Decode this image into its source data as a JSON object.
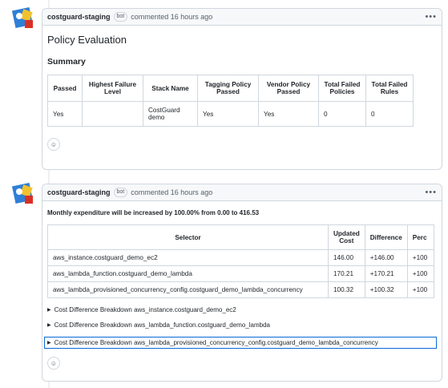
{
  "comments": [
    {
      "author": "costguard-staging",
      "badge": "bot",
      "meta": "commented 16 hours ago",
      "menu_icon": "kebab-horizontal-icon",
      "title": "Policy Evaluation",
      "section": "Summary",
      "table": {
        "headers": [
          "Passed",
          "Highest Failure Level",
          "Stack Name",
          "Tagging Policy Passed",
          "Vendor Policy Passed",
          "Total Failed Policies",
          "Total Failed Rules"
        ],
        "row": [
          "Yes",
          "",
          "CostGuard demo",
          "Yes",
          "Yes",
          "0",
          "0"
        ]
      },
      "reaction_icon": "smiley-icon"
    },
    {
      "author": "costguard-staging",
      "badge": "bot",
      "meta": "commented 16 hours ago",
      "menu_icon": "kebab-horizontal-icon",
      "summary": "Monthly expenditure will be increased by 100.00% from 0.00 to 416.53",
      "table": {
        "headers": [
          "Selector",
          "Updated Cost",
          "Difference",
          "Perc"
        ],
        "rows": [
          [
            "aws_instance.costguard_demo_ec2",
            "146.00",
            "+146.00",
            "+100"
          ],
          [
            "aws_lambda_function.costguard_demo_lambda",
            "170.21",
            "+170.21",
            "+100"
          ],
          [
            "aws_lambda_provisioned_concurrency_config.costguard_demo_lambda_concurrency",
            "100.32",
            "+100.32",
            "+100"
          ]
        ]
      },
      "details": [
        "Cost Difference Breakdown aws_instance.costguard_demo_ec2",
        "Cost Difference Breakdown aws_lambda_function.costguard_demo_lambda",
        "Cost Difference Breakdown aws_lambda_provisioned_concurrency_config.costguard_demo_lambda_concurrency"
      ],
      "reaction_icon": "smiley-icon"
    }
  ],
  "colors": {
    "avatar_blue": "#2f7fd8",
    "avatar_yellow": "#f2c12e",
    "avatar_red": "#d93025",
    "focus": "#0969da"
  }
}
